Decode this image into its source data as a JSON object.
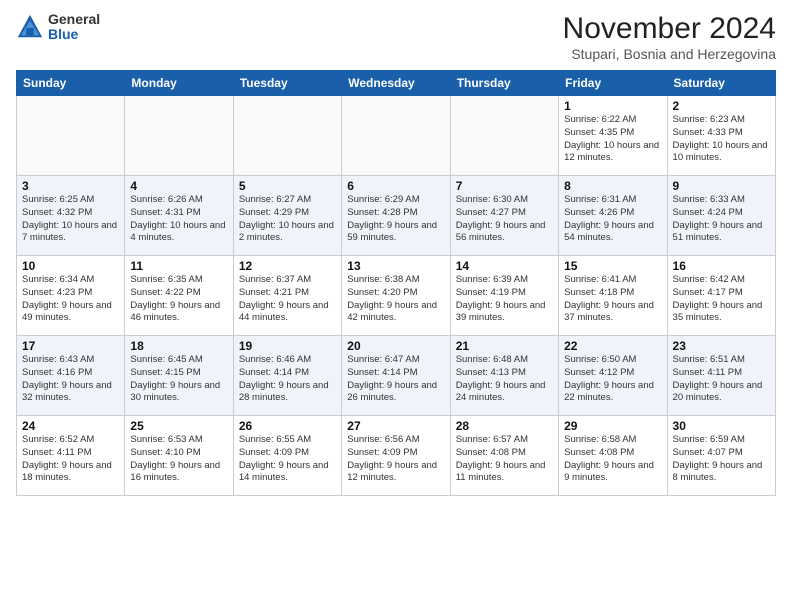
{
  "logo": {
    "general": "General",
    "blue": "Blue"
  },
  "title": "November 2024",
  "location": "Stupari, Bosnia and Herzegovina",
  "days_of_week": [
    "Sunday",
    "Monday",
    "Tuesday",
    "Wednesday",
    "Thursday",
    "Friday",
    "Saturday"
  ],
  "weeks": [
    [
      {
        "day": "",
        "info": ""
      },
      {
        "day": "",
        "info": ""
      },
      {
        "day": "",
        "info": ""
      },
      {
        "day": "",
        "info": ""
      },
      {
        "day": "",
        "info": ""
      },
      {
        "day": "1",
        "info": "Sunrise: 6:22 AM\nSunset: 4:35 PM\nDaylight: 10 hours and 12 minutes."
      },
      {
        "day": "2",
        "info": "Sunrise: 6:23 AM\nSunset: 4:33 PM\nDaylight: 10 hours and 10 minutes."
      }
    ],
    [
      {
        "day": "3",
        "info": "Sunrise: 6:25 AM\nSunset: 4:32 PM\nDaylight: 10 hours and 7 minutes."
      },
      {
        "day": "4",
        "info": "Sunrise: 6:26 AM\nSunset: 4:31 PM\nDaylight: 10 hours and 4 minutes."
      },
      {
        "day": "5",
        "info": "Sunrise: 6:27 AM\nSunset: 4:29 PM\nDaylight: 10 hours and 2 minutes."
      },
      {
        "day": "6",
        "info": "Sunrise: 6:29 AM\nSunset: 4:28 PM\nDaylight: 9 hours and 59 minutes."
      },
      {
        "day": "7",
        "info": "Sunrise: 6:30 AM\nSunset: 4:27 PM\nDaylight: 9 hours and 56 minutes."
      },
      {
        "day": "8",
        "info": "Sunrise: 6:31 AM\nSunset: 4:26 PM\nDaylight: 9 hours and 54 minutes."
      },
      {
        "day": "9",
        "info": "Sunrise: 6:33 AM\nSunset: 4:24 PM\nDaylight: 9 hours and 51 minutes."
      }
    ],
    [
      {
        "day": "10",
        "info": "Sunrise: 6:34 AM\nSunset: 4:23 PM\nDaylight: 9 hours and 49 minutes."
      },
      {
        "day": "11",
        "info": "Sunrise: 6:35 AM\nSunset: 4:22 PM\nDaylight: 9 hours and 46 minutes."
      },
      {
        "day": "12",
        "info": "Sunrise: 6:37 AM\nSunset: 4:21 PM\nDaylight: 9 hours and 44 minutes."
      },
      {
        "day": "13",
        "info": "Sunrise: 6:38 AM\nSunset: 4:20 PM\nDaylight: 9 hours and 42 minutes."
      },
      {
        "day": "14",
        "info": "Sunrise: 6:39 AM\nSunset: 4:19 PM\nDaylight: 9 hours and 39 minutes."
      },
      {
        "day": "15",
        "info": "Sunrise: 6:41 AM\nSunset: 4:18 PM\nDaylight: 9 hours and 37 minutes."
      },
      {
        "day": "16",
        "info": "Sunrise: 6:42 AM\nSunset: 4:17 PM\nDaylight: 9 hours and 35 minutes."
      }
    ],
    [
      {
        "day": "17",
        "info": "Sunrise: 6:43 AM\nSunset: 4:16 PM\nDaylight: 9 hours and 32 minutes."
      },
      {
        "day": "18",
        "info": "Sunrise: 6:45 AM\nSunset: 4:15 PM\nDaylight: 9 hours and 30 minutes."
      },
      {
        "day": "19",
        "info": "Sunrise: 6:46 AM\nSunset: 4:14 PM\nDaylight: 9 hours and 28 minutes."
      },
      {
        "day": "20",
        "info": "Sunrise: 6:47 AM\nSunset: 4:14 PM\nDaylight: 9 hours and 26 minutes."
      },
      {
        "day": "21",
        "info": "Sunrise: 6:48 AM\nSunset: 4:13 PM\nDaylight: 9 hours and 24 minutes."
      },
      {
        "day": "22",
        "info": "Sunrise: 6:50 AM\nSunset: 4:12 PM\nDaylight: 9 hours and 22 minutes."
      },
      {
        "day": "23",
        "info": "Sunrise: 6:51 AM\nSunset: 4:11 PM\nDaylight: 9 hours and 20 minutes."
      }
    ],
    [
      {
        "day": "24",
        "info": "Sunrise: 6:52 AM\nSunset: 4:11 PM\nDaylight: 9 hours and 18 minutes."
      },
      {
        "day": "25",
        "info": "Sunrise: 6:53 AM\nSunset: 4:10 PM\nDaylight: 9 hours and 16 minutes."
      },
      {
        "day": "26",
        "info": "Sunrise: 6:55 AM\nSunset: 4:09 PM\nDaylight: 9 hours and 14 minutes."
      },
      {
        "day": "27",
        "info": "Sunrise: 6:56 AM\nSunset: 4:09 PM\nDaylight: 9 hours and 12 minutes."
      },
      {
        "day": "28",
        "info": "Sunrise: 6:57 AM\nSunset: 4:08 PM\nDaylight: 9 hours and 11 minutes."
      },
      {
        "day": "29",
        "info": "Sunrise: 6:58 AM\nSunset: 4:08 PM\nDaylight: 9 hours and 9 minutes."
      },
      {
        "day": "30",
        "info": "Sunrise: 6:59 AM\nSunset: 4:07 PM\nDaylight: 9 hours and 8 minutes."
      }
    ]
  ]
}
